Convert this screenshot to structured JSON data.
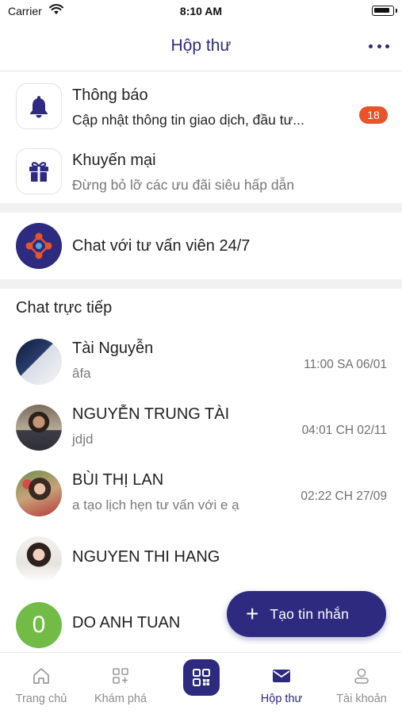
{
  "status_bar": {
    "carrier": "Carrier",
    "time": "8:10 AM"
  },
  "header": {
    "title": "Hộp thư"
  },
  "notifications": [
    {
      "title": "Thông báo",
      "subtitle": "Cập nhật thông tin giao dịch, đầu tư...",
      "badge": "18",
      "icon": "bell-icon"
    },
    {
      "title": "Khuyến mại",
      "subtitle": "Đừng bỏ lỡ các ưu đãi siêu hấp dẫn",
      "icon": "gift-icon"
    }
  ],
  "advisor": {
    "label": "Chat với tư vấn viên 24/7",
    "icon": "advisor-network-icon"
  },
  "live_chat": {
    "heading": "Chat trực tiếp",
    "items": [
      {
        "name": "Tài Nguyễn",
        "message": "âfa",
        "time": "11:00 SA 06/01"
      },
      {
        "name": "NGUYỄN TRUNG TÀI",
        "message": "jdjd",
        "time": "04:01 CH 02/11"
      },
      {
        "name": "BÙI THỊ LAN",
        "message": "a tạo lịch hẹn tư vấn với e ạ",
        "time": "02:22 CH 27/09"
      },
      {
        "name": "NGUYEN THI HANG",
        "message": "",
        "time": ""
      },
      {
        "name": "DO ANH TUAN",
        "message": "",
        "time": "",
        "initial": "0"
      }
    ]
  },
  "fab": {
    "label": "Tạo tin nhắn"
  },
  "bottom_nav": {
    "items": [
      {
        "label": "Trang chủ",
        "icon": "home-icon",
        "active": false
      },
      {
        "label": "Khám phá",
        "icon": "explore-icon",
        "active": false
      },
      {
        "label": "",
        "icon": "qr-scan-icon",
        "active": false
      },
      {
        "label": "Hộp thư",
        "icon": "mail-icon",
        "active": true
      },
      {
        "label": "Tài khoản",
        "icon": "account-icon",
        "active": false
      }
    ]
  },
  "colors": {
    "primary": "#2d2a80",
    "badge": "#e8532a",
    "avatar_green": "#72bb46",
    "inactive": "#8d8d8d"
  }
}
